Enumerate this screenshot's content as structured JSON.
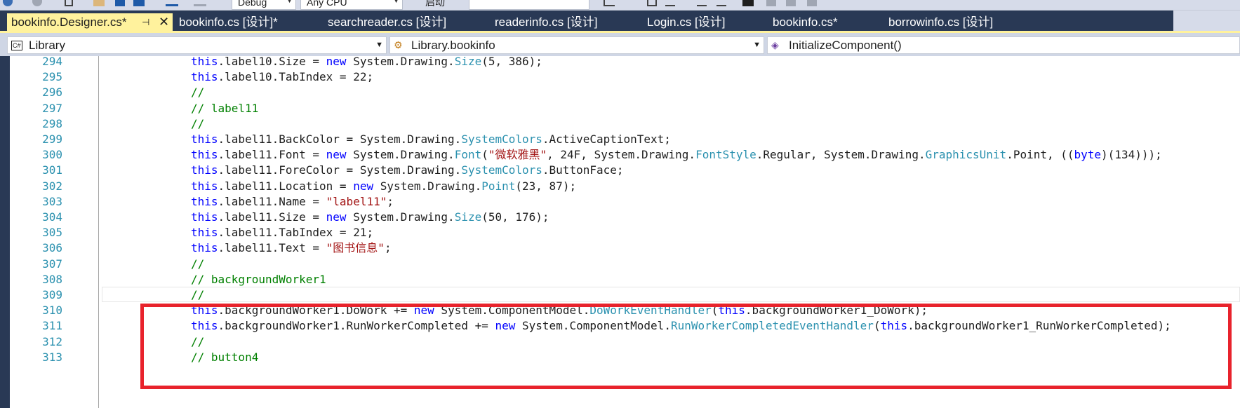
{
  "toolbar": {
    "config_combo": "Debug",
    "platform_combo": "Any CPU",
    "start_label": "启动"
  },
  "tabs": [
    {
      "label": "bookinfo.Designer.cs*",
      "active": true
    },
    {
      "label": "bookinfo.cs [设计]*"
    },
    {
      "label": "searchreader.cs [设计]"
    },
    {
      "label": "readerinfo.cs [设计]"
    },
    {
      "label": "Login.cs [设计]"
    },
    {
      "label": "bookinfo.cs*"
    },
    {
      "label": "borrowinfo.cs [设计]"
    }
  ],
  "tab_pin_glyph": "⊣",
  "tab_close_glyph": "✕",
  "navbar": {
    "project": "Library",
    "class": "Library.bookinfo",
    "member": "InitializeComponent()"
  },
  "colors": {
    "keyword": "#0000ff",
    "type": "#2b91af",
    "comment": "#008000",
    "string": "#a31515",
    "highlight_border": "#e8232c"
  },
  "code_lines": [
    {
      "num": "294",
      "tokens": [
        [
          "kw",
          "this"
        ],
        [
          "pl",
          ".label10.Size = "
        ],
        [
          "kw",
          "new"
        ],
        [
          "pl",
          " System.Drawing."
        ],
        [
          "ty",
          "Size"
        ],
        [
          "pl",
          "(5, 386);"
        ]
      ]
    },
    {
      "num": "295",
      "tokens": [
        [
          "kw",
          "this"
        ],
        [
          "pl",
          ".label10.TabIndex = 22;"
        ]
      ]
    },
    {
      "num": "296",
      "tokens": [
        [
          "cm",
          "//"
        ]
      ]
    },
    {
      "num": "297",
      "tokens": [
        [
          "cm",
          "// label11"
        ]
      ]
    },
    {
      "num": "298",
      "tokens": [
        [
          "cm",
          "//"
        ]
      ]
    },
    {
      "num": "299",
      "tokens": [
        [
          "kw",
          "this"
        ],
        [
          "pl",
          ".label11.BackColor = System.Drawing."
        ],
        [
          "ty",
          "SystemColors"
        ],
        [
          "pl",
          ".ActiveCaptionText;"
        ]
      ]
    },
    {
      "num": "300",
      "tokens": [
        [
          "kw",
          "this"
        ],
        [
          "pl",
          ".label11.Font = "
        ],
        [
          "kw",
          "new"
        ],
        [
          "pl",
          " System.Drawing."
        ],
        [
          "ty",
          "Font"
        ],
        [
          "pl",
          "("
        ],
        [
          "st",
          "\"微软雅黑\""
        ],
        [
          "pl",
          ", 24F, System.Drawing."
        ],
        [
          "ty",
          "FontStyle"
        ],
        [
          "pl",
          ".Regular, System.Drawing."
        ],
        [
          "ty",
          "GraphicsUnit"
        ],
        [
          "pl",
          ".Point, (("
        ],
        [
          "kw",
          "byte"
        ],
        [
          "pl",
          ")(134)));"
        ]
      ]
    },
    {
      "num": "301",
      "tokens": [
        [
          "kw",
          "this"
        ],
        [
          "pl",
          ".label11.ForeColor = System.Drawing."
        ],
        [
          "ty",
          "SystemColors"
        ],
        [
          "pl",
          ".ButtonFace;"
        ]
      ]
    },
    {
      "num": "302",
      "tokens": [
        [
          "kw",
          "this"
        ],
        [
          "pl",
          ".label11.Location = "
        ],
        [
          "kw",
          "new"
        ],
        [
          "pl",
          " System.Drawing."
        ],
        [
          "ty",
          "Point"
        ],
        [
          "pl",
          "(23, 87);"
        ]
      ]
    },
    {
      "num": "303",
      "tokens": [
        [
          "kw",
          "this"
        ],
        [
          "pl",
          ".label11.Name = "
        ],
        [
          "st",
          "\"label11\""
        ],
        [
          "pl",
          ";"
        ]
      ]
    },
    {
      "num": "304",
      "tokens": [
        [
          "kw",
          "this"
        ],
        [
          "pl",
          ".label11.Size = "
        ],
        [
          "kw",
          "new"
        ],
        [
          "pl",
          " System.Drawing."
        ],
        [
          "ty",
          "Size"
        ],
        [
          "pl",
          "(50, 176);"
        ]
      ]
    },
    {
      "num": "305",
      "tokens": [
        [
          "kw",
          "this"
        ],
        [
          "pl",
          ".label11.TabIndex = 21;"
        ]
      ]
    },
    {
      "num": "306",
      "tokens": [
        [
          "kw",
          "this"
        ],
        [
          "pl",
          ".label11.Text = "
        ],
        [
          "st",
          "\"图书信息\""
        ],
        [
          "pl",
          ";"
        ]
      ]
    },
    {
      "num": "307",
      "tokens": [
        [
          "cm",
          "//"
        ]
      ]
    },
    {
      "num": "308",
      "tokens": [
        [
          "cm",
          "// backgroundWorker1"
        ]
      ]
    },
    {
      "num": "309",
      "tokens": [
        [
          "cm",
          "//"
        ]
      ],
      "current": true
    },
    {
      "num": "310",
      "tokens": [
        [
          "kw",
          "this"
        ],
        [
          "pl",
          ".backgroundWorker1.DoWork += "
        ],
        [
          "kw",
          "new"
        ],
        [
          "pl",
          " System.ComponentModel."
        ],
        [
          "ty",
          "DoWorkEventHandler"
        ],
        [
          "pl",
          "("
        ],
        [
          "kw",
          "this"
        ],
        [
          "pl",
          ".backgroundWorker1_DoWork);"
        ]
      ]
    },
    {
      "num": "311",
      "tokens": [
        [
          "kw",
          "this"
        ],
        [
          "pl",
          ".backgroundWorker1.RunWorkerCompleted += "
        ],
        [
          "kw",
          "new"
        ],
        [
          "pl",
          " System.ComponentModel."
        ],
        [
          "ty",
          "RunWorkerCompletedEventHandler"
        ],
        [
          "pl",
          "("
        ],
        [
          "kw",
          "this"
        ],
        [
          "pl",
          ".backgroundWorker1_RunWorkerCompleted);"
        ]
      ]
    },
    {
      "num": "312",
      "tokens": [
        [
          "cm",
          "//"
        ]
      ]
    },
    {
      "num": "313",
      "tokens": [
        [
          "cm",
          "// button4"
        ]
      ]
    }
  ]
}
